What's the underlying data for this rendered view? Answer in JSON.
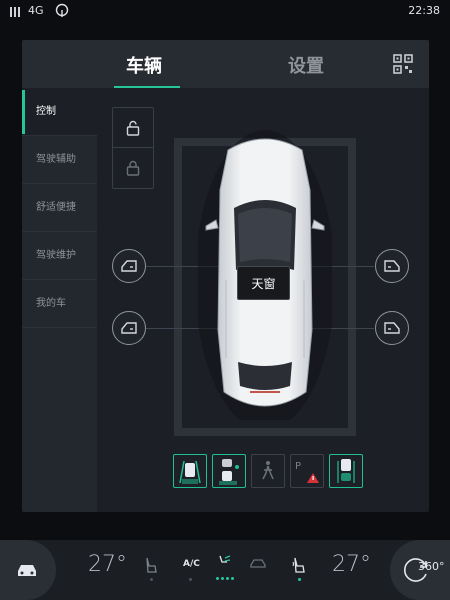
{
  "status_bar": {
    "network": "4G",
    "time": "22:38"
  },
  "tabs": [
    {
      "label": "车辆",
      "active": true
    },
    {
      "label": "设置",
      "active": false
    }
  ],
  "side_menu": [
    {
      "label": "控制",
      "active": true
    },
    {
      "label": "驾驶辅助",
      "active": false
    },
    {
      "label": "舒适便捷",
      "active": false
    },
    {
      "label": "驾驶维护",
      "active": false
    },
    {
      "label": "我的车",
      "active": false
    }
  ],
  "vehicle": {
    "sunroof_label": "天窗"
  },
  "climate": {
    "left_temp": "27°",
    "right_temp": "27°",
    "ac_label": "A/C"
  },
  "view360_label": "360°",
  "colors": {
    "accent": "#27c59a",
    "background": "#0b0d10",
    "panel": "#1c1f25"
  }
}
